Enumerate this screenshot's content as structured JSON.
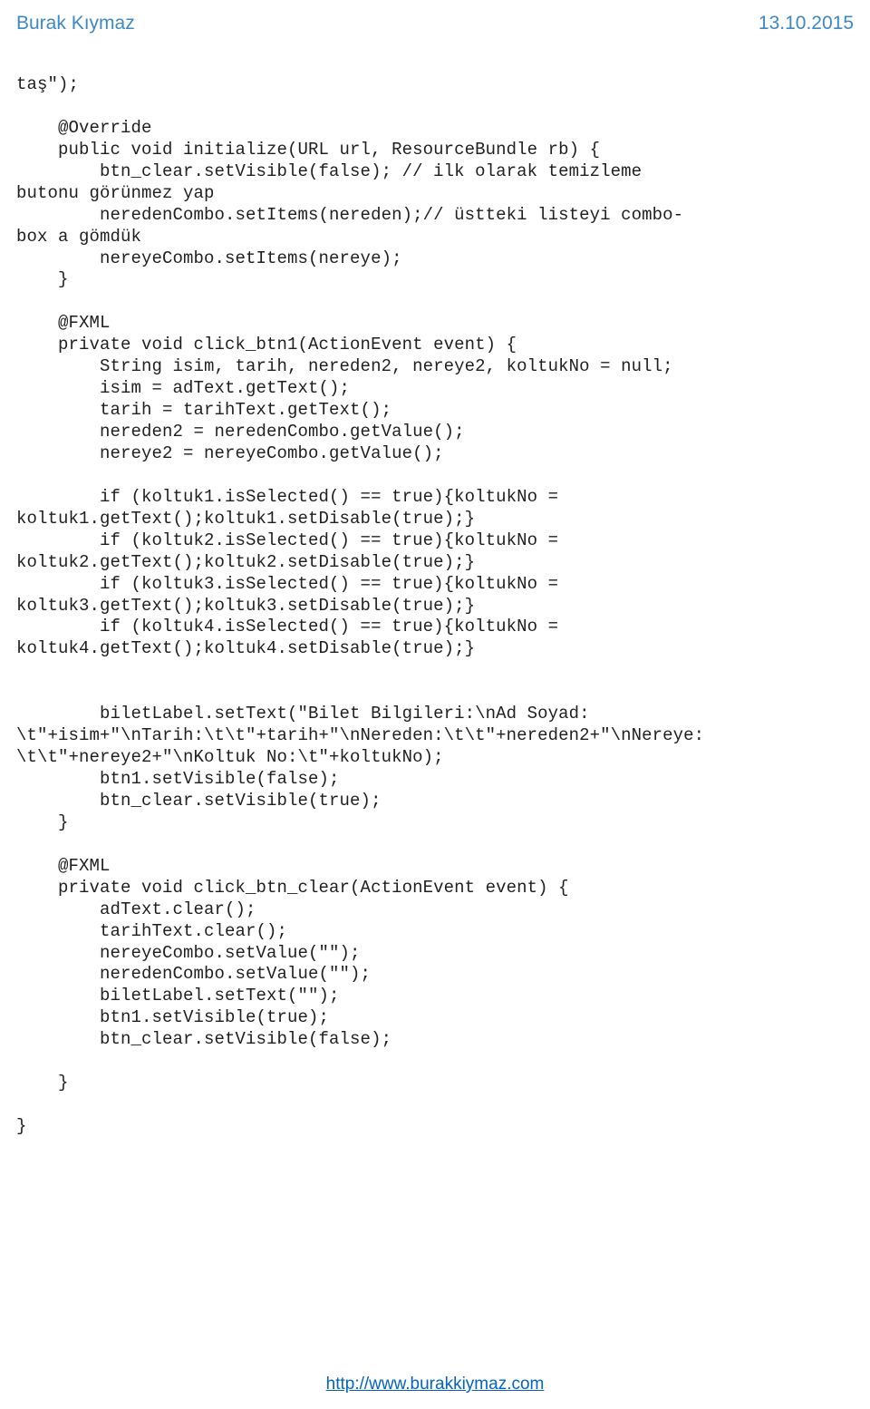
{
  "header": {
    "author": "Burak Kıymaz",
    "date": "13.10.2015"
  },
  "code": "taş\");\n\n    @Override\n    public void initialize(URL url, ResourceBundle rb) {\n        btn_clear.setVisible(false); // ilk olarak temizleme\nbutonu görünmez yap\n        neredenCombo.setItems(nereden);// üstteki listeyi combo-\nbox a gömdük\n        nereyeCombo.setItems(nereye);\n    }\n\n    @FXML\n    private void click_btn1(ActionEvent event) {\n        String isim, tarih, nereden2, nereye2, koltukNo = null;\n        isim = adText.getText();\n        tarih = tarihText.getText();\n        nereden2 = neredenCombo.getValue();\n        nereye2 = nereyeCombo.getValue();\n\n        if (koltuk1.isSelected() == true){koltukNo =\nkoltuk1.getText();koltuk1.setDisable(true);}\n        if (koltuk2.isSelected() == true){koltukNo =\nkoltuk2.getText();koltuk2.setDisable(true);}\n        if (koltuk3.isSelected() == true){koltukNo =\nkoltuk3.getText();koltuk3.setDisable(true);}\n        if (koltuk4.isSelected() == true){koltukNo =\nkoltuk4.getText();koltuk4.setDisable(true);}\n\n\n        biletLabel.setText(\"Bilet Bilgileri:\\nAd Soyad:\n\\t\"+isim+\"\\nTarih:\\t\\t\"+tarih+\"\\nNereden:\\t\\t\"+nereden2+\"\\nNereye:\n\\t\\t\"+nereye2+\"\\nKoltuk No:\\t\"+koltukNo);\n        btn1.setVisible(false);\n        btn_clear.setVisible(true);\n    }\n\n    @FXML\n    private void click_btn_clear(ActionEvent event) {\n        adText.clear();\n        tarihText.clear();\n        nereyeCombo.setValue(\"\");\n        neredenCombo.setValue(\"\");\n        biletLabel.setText(\"\");\n        btn1.setVisible(true);\n        btn_clear.setVisible(false);\n\n    }\n\n}",
  "footer": {
    "url_text": "http://www.burakkiymaz.com"
  }
}
